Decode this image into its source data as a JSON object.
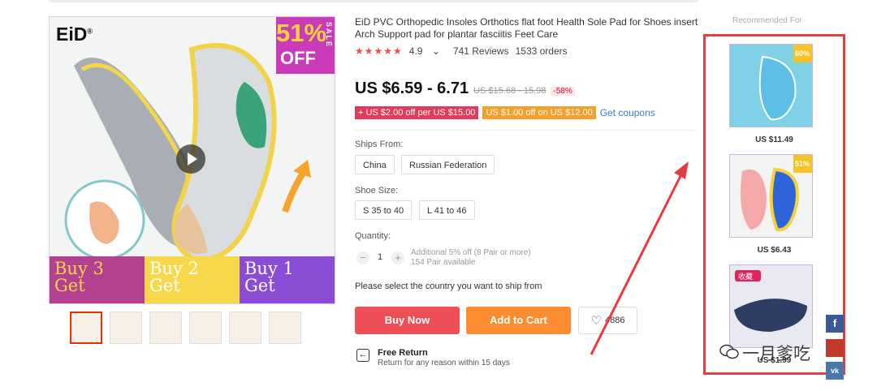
{
  "gallery": {
    "brand": "EiD",
    "brand_mark": "®",
    "promo_percent": "51%",
    "promo_off": "OFF",
    "promo_sale": "SALE",
    "bundles": [
      {
        "top": "Buy 3",
        "bottom": "Get"
      },
      {
        "top": "Buy 2",
        "bottom": "Get"
      },
      {
        "top": "Buy 1",
        "bottom": "Get"
      }
    ],
    "thumbnail_count": 6
  },
  "product": {
    "title": "EiD PVC Orthopedic Insoles Orthotics flat foot Health Sole Pad for Shoes insert Arch Support pad for plantar fasciitis Feet Care",
    "stars": "★★★★★",
    "rating": "4.9",
    "rating_caret": "⌄",
    "reviews": "741 Reviews",
    "orders": "1533 orders",
    "price": "US $6.59 - 6.71",
    "old_price": "US $15.68 - 15.98",
    "discount": "-58%",
    "coupon1": "+ US $2.00 off per US $15.00",
    "coupon2": "US $1.00 off on US $12.00",
    "get_coupons": "Get coupons",
    "ships_from_label": "Ships From:",
    "ships_from_options": [
      "China",
      "Russian Federation"
    ],
    "shoe_size_label": "Shoe Size:",
    "shoe_size_options": [
      "S 35 to 40",
      "L 41 to 46"
    ],
    "quantity_label": "Quantity:",
    "quantity_minus": "−",
    "quantity_value": "1",
    "quantity_plus": "+",
    "quantity_note1": "Additional 5% off (8 Pair or more)",
    "quantity_note2": "154 Pair available",
    "ship_note": "Please select the country you want to ship from",
    "buy_now": "Buy Now",
    "add_to_cart": "Add to Cart",
    "wishlist_count": "4886",
    "free_return_title": "Free Return",
    "free_return_sub": "Return for any reason within 15 days"
  },
  "recommended": {
    "title": "Recommended For",
    "items": [
      {
        "price": "US $11.49",
        "badge": "60%"
      },
      {
        "price": "US $6.43",
        "badge": "51%"
      },
      {
        "price": "US $1.99",
        "badge": "收藏"
      }
    ]
  },
  "social": {
    "facebook": "f",
    "vk": "vk"
  },
  "watermark": "一月爹吃",
  "colors": {
    "accent_red": "#ee4f57",
    "accent_orange": "#fb8c2f",
    "annotation_red": "#e43d3d"
  }
}
